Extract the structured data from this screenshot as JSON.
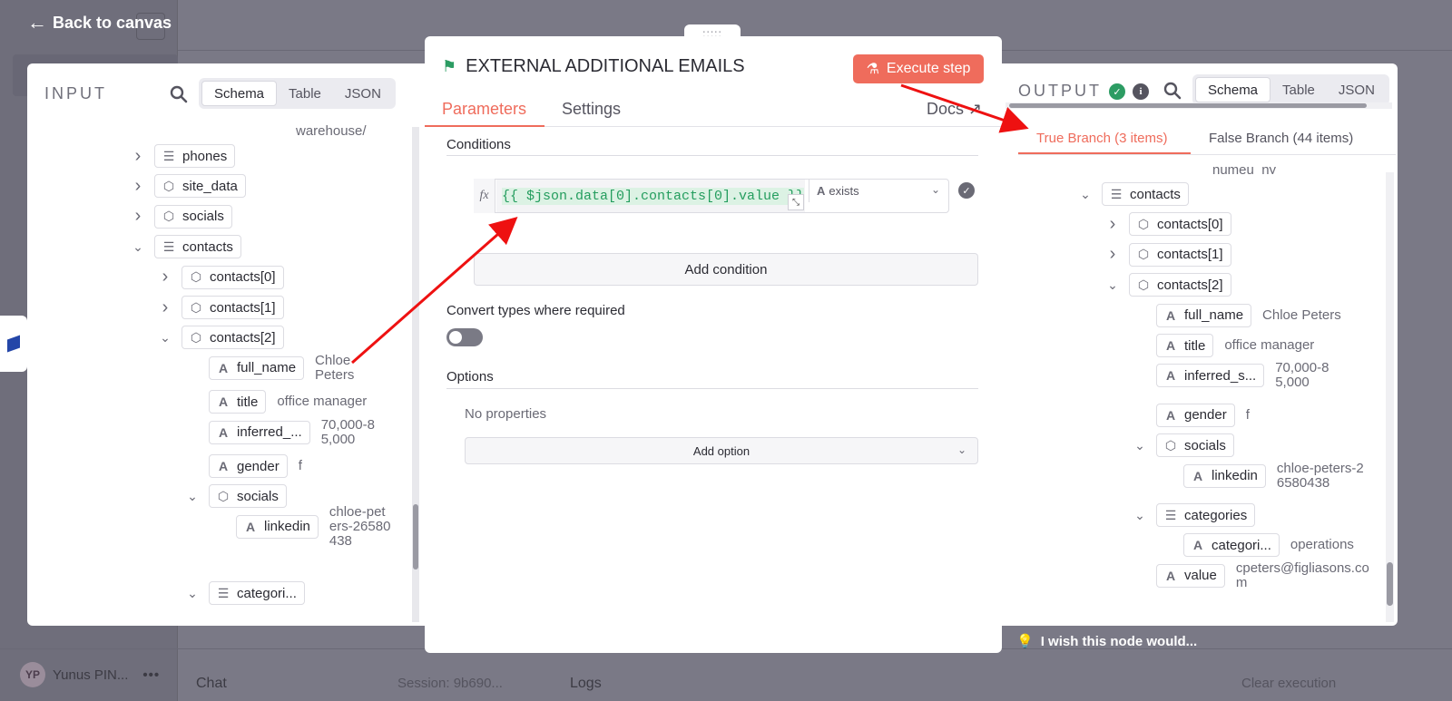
{
  "app": {
    "back_label": "Back to canvas",
    "user_initials": "YP",
    "user_name": "Yunus PIN...",
    "more": "•••",
    "chat_label": "Chat",
    "session_label": "Session: 9b690...",
    "logs_label": "Logs",
    "clear_label": "Clear execution",
    "wish_label": "I wish this node would..."
  },
  "input": {
    "title": "INPUT",
    "tabs": [
      "Schema",
      "Table",
      "JSON"
    ],
    "active_tab": "Schema",
    "partial_value": "warehouse/",
    "rows": [
      {
        "key": "phones",
        "type": "list",
        "chev": "›",
        "depth": 0
      },
      {
        "key": "site_data",
        "type": "object",
        "chev": "›",
        "depth": 0
      },
      {
        "key": "socials",
        "type": "object",
        "chev": "›",
        "depth": 0
      },
      {
        "key": "contacts",
        "type": "list",
        "chev": "⌄",
        "depth": 0
      },
      {
        "key": "contacts[0]",
        "type": "object",
        "chev": "›",
        "depth": 1
      },
      {
        "key": "contacts[1]",
        "type": "object",
        "chev": "›",
        "depth": 1
      },
      {
        "key": "contacts[2]",
        "type": "object",
        "chev": "⌄",
        "depth": 1
      },
      {
        "key": "full_name",
        "type": "string",
        "value": "Chloe Peters",
        "depth": 2
      },
      {
        "key": "title",
        "type": "string",
        "value": "office manager",
        "depth": 2
      },
      {
        "key": "inferred_...",
        "type": "string",
        "value": "70,000-85,000",
        "depth": 2
      },
      {
        "key": "gender",
        "type": "string",
        "value": "f",
        "depth": 2
      },
      {
        "key": "socials",
        "type": "object",
        "chev": "⌄",
        "depth": 2
      },
      {
        "key": "linkedin",
        "type": "string",
        "value": "chloe-peters-26580438",
        "depth": 3
      },
      {
        "key": "categori...",
        "type": "list",
        "chev": "⌄",
        "depth": 2
      }
    ]
  },
  "node": {
    "title": "EXTERNAL ADDITIONAL EMAILS",
    "execute_label": "Execute step",
    "tabs": [
      "Parameters",
      "Settings"
    ],
    "docs_label": "Docs",
    "conditions_title": "Conditions",
    "expression": "{{ $json.data[0].contacts[0].value }}",
    "operator": "exists",
    "add_condition_label": "Add condition",
    "convert_label": "Convert types where required",
    "convert_enabled": false,
    "options_title": "Options",
    "no_properties": "No properties",
    "add_option_label": "Add option"
  },
  "output": {
    "title": "OUTPUT",
    "tabs": [
      "Schema",
      "Table",
      "JSON"
    ],
    "active_tab": "Schema",
    "true_branch": "True Branch (3 items)",
    "false_branch": "False Branch (44 items)",
    "partial_value": "numeu_ny",
    "rows": [
      {
        "key": "contacts",
        "type": "list",
        "chev": "⌄",
        "depth": 0
      },
      {
        "key": "contacts[0]",
        "type": "object",
        "chev": "›",
        "depth": 1
      },
      {
        "key": "contacts[1]",
        "type": "object",
        "chev": "›",
        "depth": 1
      },
      {
        "key": "contacts[2]",
        "type": "object",
        "chev": "⌄",
        "depth": 1
      },
      {
        "key": "full_name",
        "type": "string",
        "value": "Chloe Peters",
        "depth": 2
      },
      {
        "key": "title",
        "type": "string",
        "value": "office manager",
        "depth": 2
      },
      {
        "key": "inferred_s...",
        "type": "string",
        "value": "70,000-85,000",
        "depth": 2
      },
      {
        "key": "gender",
        "type": "string",
        "value": "f",
        "depth": 2
      },
      {
        "key": "socials",
        "type": "object",
        "chev": "⌄",
        "depth": 2
      },
      {
        "key": "linkedin",
        "type": "string",
        "value": "chloe-peters-26580438",
        "depth": 3
      },
      {
        "key": "categories",
        "type": "list",
        "chev": "⌄",
        "depth": 2
      },
      {
        "key": "categori...",
        "type": "string",
        "value": "operations",
        "depth": 3
      },
      {
        "key": "value",
        "type": "string",
        "value": "cpeters@figliasons.com",
        "depth": 2
      }
    ]
  },
  "colors": {
    "accent": "#ef6c5c",
    "success": "#2c9c63",
    "annotation_arrow": "#ee1111"
  }
}
